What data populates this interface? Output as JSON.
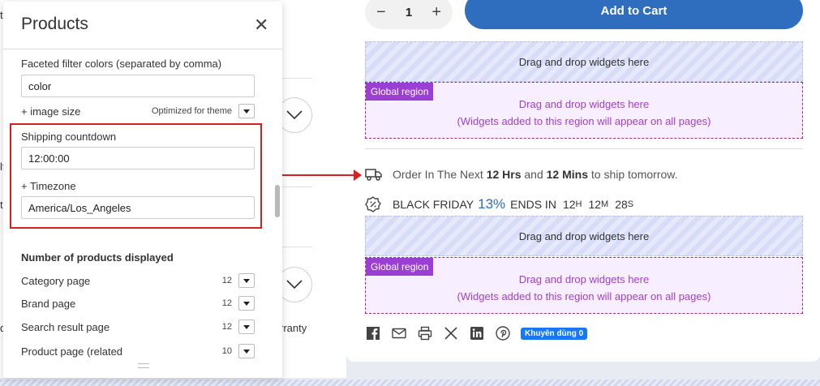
{
  "panel": {
    "title": "Products",
    "close_icon": "close-icon",
    "faceted_label": "Faceted filter colors (separated by comma)",
    "faceted_value": "color",
    "image_size_label": "+ image size",
    "image_size_value": "Optimized for theme",
    "shipping_label": "Shipping countdown",
    "shipping_value": "12:00:00",
    "timezone_label": "+ Timezone",
    "timezone_value": "America/Los_Angeles",
    "products_heading": "Number of products displayed",
    "product_rows": [
      {
        "label": "Category page",
        "value": "12"
      },
      {
        "label": "Brand page",
        "value": "12"
      },
      {
        "label": "Search result page",
        "value": "12"
      },
      {
        "label": "Product page (related",
        "value": "10"
      }
    ]
  },
  "background": {
    "edge_t": "t",
    "edge_lt": "lt",
    "edge_d": "d",
    "warranty": "rranty"
  },
  "product": {
    "qty_minus": "−",
    "qty_value": "1",
    "qty_plus": "+",
    "add_to_cart": "Add to Cart",
    "drop_text": "Drag and drop widgets here",
    "global_region_tag": "Global region",
    "global_region_line1": "Drag and drop widgets here",
    "global_region_line2": "(Widgets added to this region will appear on all pages)",
    "ship_pre": "Order In The Next ",
    "ship_hrs": "12 Hrs",
    "ship_and": " and ",
    "ship_mins": "12 Mins",
    "ship_post": " to ship tomorrow.",
    "bf_pre": "BLACK FRIDAY",
    "bf_pct": "13%",
    "bf_ends": "ENDS IN",
    "bf_h": "12",
    "bf_h_unit": "H",
    "bf_m": "12",
    "bf_m_unit": "M",
    "bf_s": "28",
    "bf_s_unit": "S",
    "like_label": "Khuyên dùng 0"
  },
  "colors": {
    "accent_blue": "#2f6dbf",
    "highlight_red": "#d42020",
    "global_region_purple": "#9b3ed3"
  }
}
